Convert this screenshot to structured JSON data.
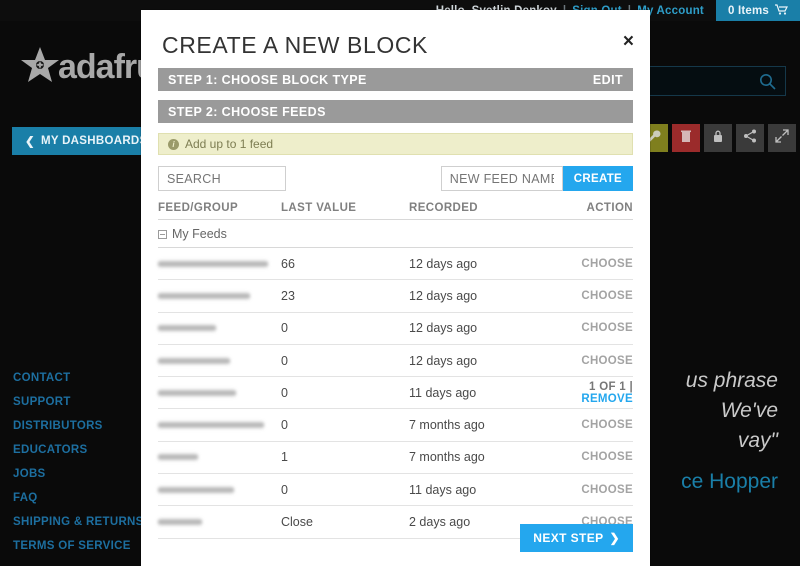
{
  "site": {
    "greeting": "Hello, Svetlin Denkov",
    "separator": "|",
    "sign_out": "Sign Out",
    "my_account": "My Account",
    "cart_label": "0 Items",
    "logo_word": "adafruit",
    "dashboards_button": "MY DASHBOARDS",
    "footer_links": [
      "CONTACT",
      "SUPPORT",
      "DISTRIBUTORS",
      "EDUCATORS",
      "JOBS",
      "FAQ",
      "SHIPPING & RETURNS",
      "TERMS OF SERVICE"
    ],
    "quote_line1": "us phrase",
    "quote_line2": "We've",
    "quote_line3": "vay\"",
    "quote_author": "ce Hopper",
    "toolbar_icons": [
      "wrench-icon",
      "trash-icon",
      "lock-icon",
      "share-icon",
      "expand-icon"
    ],
    "accent_blue": "#1a7fa8",
    "link_blue": "#2e9ec9"
  },
  "modal": {
    "title": "CREATE A NEW BLOCK",
    "close_label": "×",
    "step1_label": "STEP 1: CHOOSE BLOCK TYPE",
    "step1_action": "EDIT",
    "step2_label": "STEP 2: CHOOSE FEEDS",
    "notice_text": "Add up to 1 feed",
    "search_placeholder": "SEARCH",
    "search_value": "",
    "newfeed_placeholder": "NEW FEED NAME",
    "newfeed_value": "",
    "create_button": "CREATE",
    "columns": {
      "feed_group": "FEED/GROUP",
      "last_value": "LAST VALUE",
      "recorded": "RECORDED",
      "action": "ACTION"
    },
    "group_name": "My Feeds",
    "rows": [
      {
        "name": "",
        "redact_width": 110,
        "last_value": "66",
        "recorded": "12 days ago",
        "action": "CHOOSE",
        "selected": false
      },
      {
        "name": "",
        "redact_width": 92,
        "last_value": "23",
        "recorded": "12 days ago",
        "action": "CHOOSE",
        "selected": false
      },
      {
        "name": "",
        "redact_width": 58,
        "last_value": "0",
        "recorded": "12 days ago",
        "action": "CHOOSE",
        "selected": false
      },
      {
        "name": "",
        "redact_width": 72,
        "last_value": "0",
        "recorded": "12 days ago",
        "action": "CHOOSE",
        "selected": false
      },
      {
        "name": "",
        "redact_width": 78,
        "last_value": "0",
        "recorded": "11 days ago",
        "action": "REMOVE",
        "action_prefix": "1 OF 1 | ",
        "selected": true
      },
      {
        "name": "",
        "redact_width": 106,
        "last_value": "0",
        "recorded": "7 months ago",
        "action": "CHOOSE",
        "selected": false
      },
      {
        "name": "",
        "redact_width": 40,
        "last_value": "1",
        "recorded": "7 months ago",
        "action": "CHOOSE",
        "selected": false
      },
      {
        "name": "",
        "redact_width": 76,
        "last_value": "0",
        "recorded": "11 days ago",
        "action": "CHOOSE",
        "selected": false
      },
      {
        "name": "",
        "redact_width": 44,
        "last_value": "Close",
        "recorded": "2 days ago",
        "action": "CHOOSE",
        "selected": false
      }
    ],
    "next_button": "NEXT STEP",
    "next_chevron": "❯",
    "accent_blue": "#24a7ee",
    "step_bar_gray": "#9a9a9a",
    "notice_bg": "#eeeecb"
  }
}
